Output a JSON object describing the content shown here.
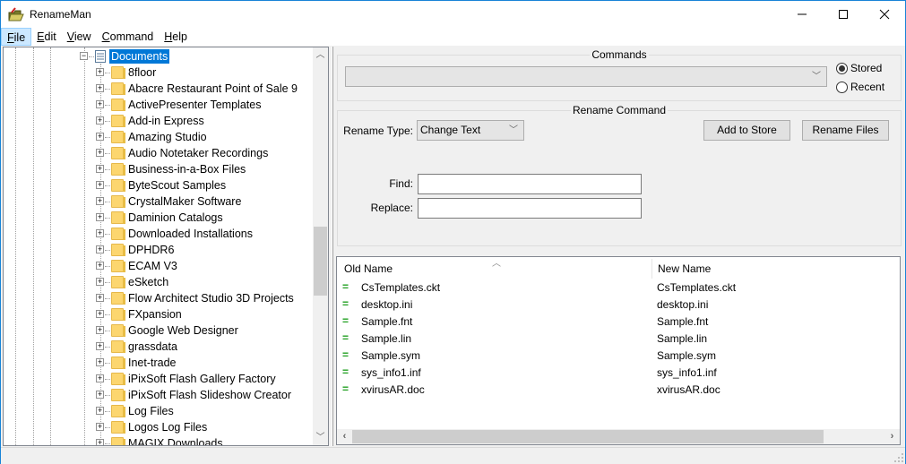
{
  "window": {
    "title": "RenameMan",
    "controls": {
      "minimize": "–",
      "maximize": "☐",
      "close": "✕"
    }
  },
  "menu": [
    {
      "label": "File",
      "accel": "F",
      "rest": "ile"
    },
    {
      "label": "Edit",
      "accel": "E",
      "rest": "dit"
    },
    {
      "label": "View",
      "accel": "V",
      "rest": "iew"
    },
    {
      "label": "Command",
      "accel": "C",
      "rest": "ommand"
    },
    {
      "label": "Help",
      "accel": "H",
      "rest": "elp"
    }
  ],
  "tree": {
    "selected": "Documents",
    "children": [
      "8floor",
      "Abacre Restaurant Point of Sale 9",
      "ActivePresenter Templates",
      "Add-in Express",
      "Amazing Studio",
      "Audio Notetaker Recordings",
      "Business-in-a-Box Files",
      "ByteScout Samples",
      "CrystalMaker Software",
      "Daminion Catalogs",
      "Downloaded Installations",
      "DPHDR6",
      "ECAM V3",
      "eSketch",
      "Flow Architect Studio 3D Projects",
      "FXpansion",
      "Google Web Designer",
      "grassdata",
      "Inet-trade",
      "iPixSoft Flash Gallery Factory",
      "iPixSoft Flash Slideshow Creator",
      "Log Files",
      "Logos Log Files",
      "MAGIX Downloads"
    ]
  },
  "commands": {
    "legend": "Commands",
    "combo_value": "",
    "radio_stored": "Stored",
    "radio_recent": "Recent",
    "selected": "Stored"
  },
  "rename_command": {
    "legend": "Rename Command",
    "type_label": "Rename Type:",
    "type_value": "Change Text",
    "add_to_store": "Add to Store",
    "rename_files": "Rename Files",
    "find_label": "Find:",
    "find_value": "",
    "replace_label": "Replace:",
    "replace_value": ""
  },
  "file_list": {
    "columns": {
      "old": "Old Name",
      "new": "New Name"
    },
    "status_symbol": "=",
    "status_color": "#22a022",
    "rows": [
      {
        "old": "CsTemplates.ckt",
        "new": "CsTemplates.ckt"
      },
      {
        "old": "desktop.ini",
        "new": "desktop.ini"
      },
      {
        "old": "Sample.fnt",
        "new": "Sample.fnt"
      },
      {
        "old": "Sample.lin",
        "new": "Sample.lin"
      },
      {
        "old": "Sample.sym",
        "new": "Sample.sym"
      },
      {
        "old": "sys_info1.inf",
        "new": "sys_info1.inf"
      },
      {
        "old": "xvirusAR.doc",
        "new": "xvirusAR.doc"
      }
    ]
  },
  "colors": {
    "selection": "#0078d7",
    "window_border": "#1883d7",
    "folder": "#fcd66f"
  }
}
